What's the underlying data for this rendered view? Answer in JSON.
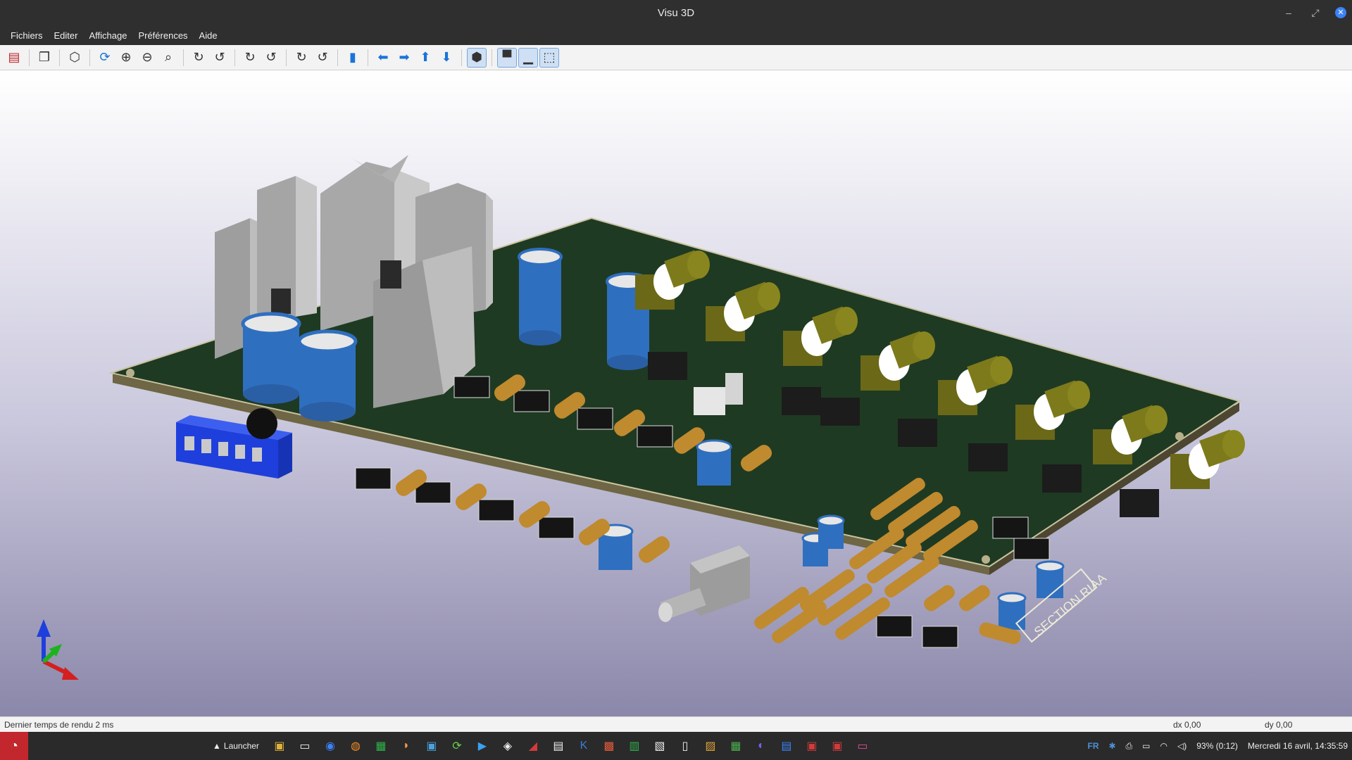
{
  "window": {
    "title": "Visu 3D"
  },
  "menu": [
    "Fichiers",
    "Editer",
    "Affichage",
    "Préférences",
    "Aide"
  ],
  "toolbar": {
    "buttons": [
      {
        "name": "export-icon",
        "glyph": "▤"
      },
      {
        "name": "copy-icon",
        "glyph": "❐"
      },
      {
        "name": "3d-view-icon",
        "glyph": "⬡"
      },
      {
        "name": "refresh-icon",
        "glyph": "⟳"
      },
      {
        "name": "zoom-in-icon",
        "glyph": "⊕"
      },
      {
        "name": "zoom-out-icon",
        "glyph": "⊖"
      },
      {
        "name": "zoom-fit-icon",
        "glyph": "⌕"
      },
      {
        "name": "rotate-x-cw-icon",
        "glyph": "↻"
      },
      {
        "name": "rotate-x-ccw-icon",
        "glyph": "↺"
      },
      {
        "name": "rotate-y-cw-icon",
        "glyph": "↻"
      },
      {
        "name": "rotate-y-ccw-icon",
        "glyph": "↺"
      },
      {
        "name": "rotate-z-cw-icon",
        "glyph": "↻"
      },
      {
        "name": "rotate-z-ccw-icon",
        "glyph": "↺"
      },
      {
        "name": "flip-board-icon",
        "glyph": "▮"
      },
      {
        "name": "arrow-left-icon",
        "glyph": "⬅"
      },
      {
        "name": "arrow-right-icon",
        "glyph": "➡"
      },
      {
        "name": "arrow-up-icon",
        "glyph": "⬆"
      },
      {
        "name": "arrow-down-icon",
        "glyph": "⬇"
      },
      {
        "name": "ortho-view-icon",
        "glyph": "⬢"
      },
      {
        "name": "body-style-icon",
        "glyph": "▀"
      },
      {
        "name": "smd-icon",
        "glyph": "▁"
      },
      {
        "name": "virtual-icon",
        "glyph": "⬚"
      }
    ]
  },
  "board": {
    "silkscreen": "SECTION RIAA"
  },
  "status": {
    "render_time": "Dernier temps de rendu 2 ms",
    "dx": "dx 0,00",
    "dy": "dy 0,00"
  },
  "taskbar": {
    "launcher": "Launcher",
    "lang": "FR",
    "battery": "93% (0:12)",
    "clock": "Mercredi 16 avril, 14:35:59"
  },
  "colors": {
    "pcb": "#1f3a22",
    "capacitor": "#2f6fbf",
    "heatsink": "#a9a9a9",
    "connector": "#7d7a1c",
    "film_cap": "#c08a2e"
  }
}
